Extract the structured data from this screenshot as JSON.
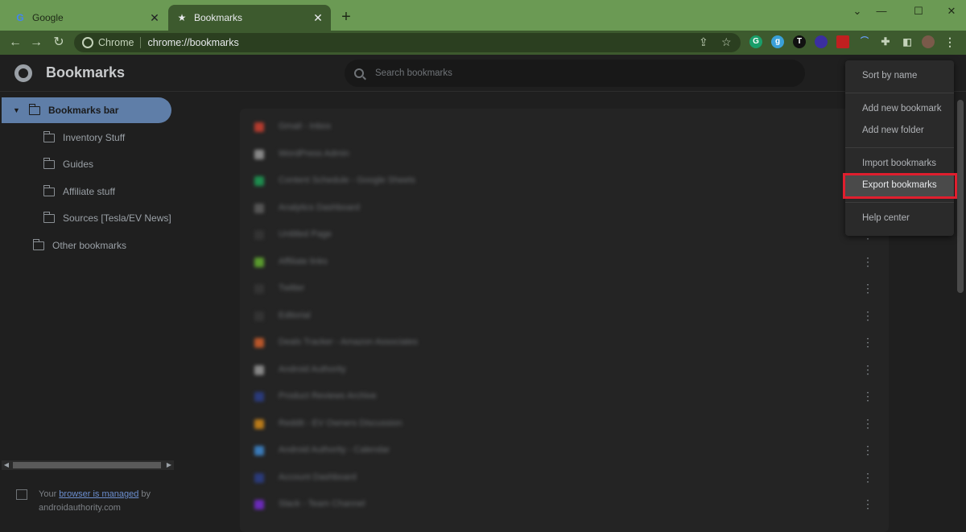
{
  "browser": {
    "tabs": [
      {
        "title": "Google",
        "favicon": "google-icon",
        "active": false
      },
      {
        "title": "Bookmarks",
        "favicon": "star-icon",
        "active": true
      }
    ],
    "newtab_label": "+",
    "omnibox": {
      "site_chip": "Chrome",
      "url": "chrome://bookmarks"
    },
    "extensions": [
      "G",
      "g",
      "T",
      "",
      "",
      "",
      "",
      ""
    ]
  },
  "page": {
    "title": "Bookmarks",
    "search_placeholder": "Search bookmarks"
  },
  "sidebar": {
    "items": [
      {
        "label": "Bookmarks bar",
        "selected": true
      },
      {
        "label": "Inventory Stuff"
      },
      {
        "label": "Guides"
      },
      {
        "label": "Affiliate stuff"
      },
      {
        "label": "Sources [Tesla/EV News]"
      },
      {
        "label": "Other bookmarks"
      }
    ],
    "managed": {
      "prefix": "Your",
      "link": "browser is managed",
      "suffix": "by",
      "domain": "androidauthority.com"
    }
  },
  "bookmarks": [
    {
      "title": "Gmail - Inbox",
      "color": "#b33b2e"
    },
    {
      "title": "WordPress Admin",
      "color": "#888888"
    },
    {
      "title": "Content Schedule - Google Sheets",
      "color": "#1e8c4e"
    },
    {
      "title": "Analytics Dashboard",
      "color": "#555555"
    },
    {
      "title": "Untitled Page",
      "color": "#333333"
    },
    {
      "title": "Affiliate links",
      "color": "#5a9a2e"
    },
    {
      "title": "Twitter",
      "color": "#333333"
    },
    {
      "title": "Editorial",
      "color": "#333333"
    },
    {
      "title": "Deals Tracker - Amazon Associates",
      "color": "#b8562a"
    },
    {
      "title": "Android Authority",
      "color": "#888888"
    },
    {
      "title": "Product Reviews Archive",
      "color": "#2a3a7a"
    },
    {
      "title": "Reddit - EV Owners Discussion",
      "color": "#b87a1a"
    },
    {
      "title": "Android Authority - Calendar",
      "color": "#3a7ab8"
    },
    {
      "title": "Account Dashboard",
      "color": "#2a3a7a"
    },
    {
      "title": "Slack - Team Channel",
      "color": "#6a2ab8"
    }
  ],
  "menu": {
    "items": [
      {
        "label": "Sort by name"
      },
      {
        "label": "Add new bookmark"
      },
      {
        "label": "Add new folder"
      },
      {
        "label": "Import bookmarks"
      },
      {
        "label": "Export bookmarks",
        "highlighted": true
      },
      {
        "label": "Help center"
      }
    ]
  },
  "colors": {
    "tabstrip": "#6b9a54",
    "toolbar": "#3d5a2e",
    "selected": "#5f7ea8",
    "highlight_box": "#e01e2e"
  }
}
